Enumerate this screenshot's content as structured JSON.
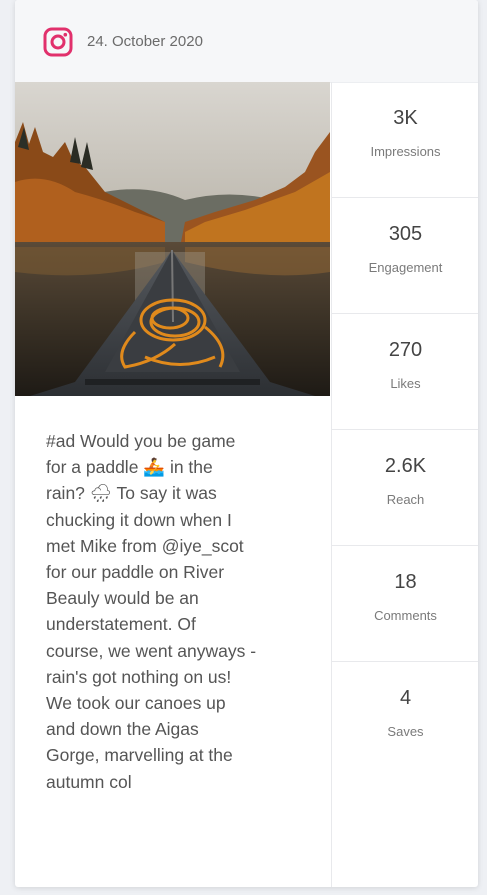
{
  "post": {
    "platform_icon": "instagram-icon",
    "date": "24. October 2020",
    "caption_lines": [
      "#ad Would you be game",
      "for a paddle 🚣 in the",
      "rain? 🌧 To say it was",
      "chucking it down when I",
      "met Mike from @iye_scot",
      "for our paddle on River",
      "Beauly would be an",
      "understatement. Of",
      "course, we went anyways -",
      "rain's got nothing on us!",
      "We took our canoes up",
      "and down the Aigas",
      "Gorge, marvelling at the",
      "autumn col"
    ]
  },
  "stats": [
    {
      "value": "3K",
      "label": "Impressions"
    },
    {
      "value": "305",
      "label": "Engagement"
    },
    {
      "value": "270",
      "label": "Likes"
    },
    {
      "value": "2.6K",
      "label": "Reach"
    },
    {
      "value": "18",
      "label": "Comments"
    },
    {
      "value": "4",
      "label": "Saves"
    }
  ],
  "colors": {
    "instagram_accent": "#e1306c"
  }
}
